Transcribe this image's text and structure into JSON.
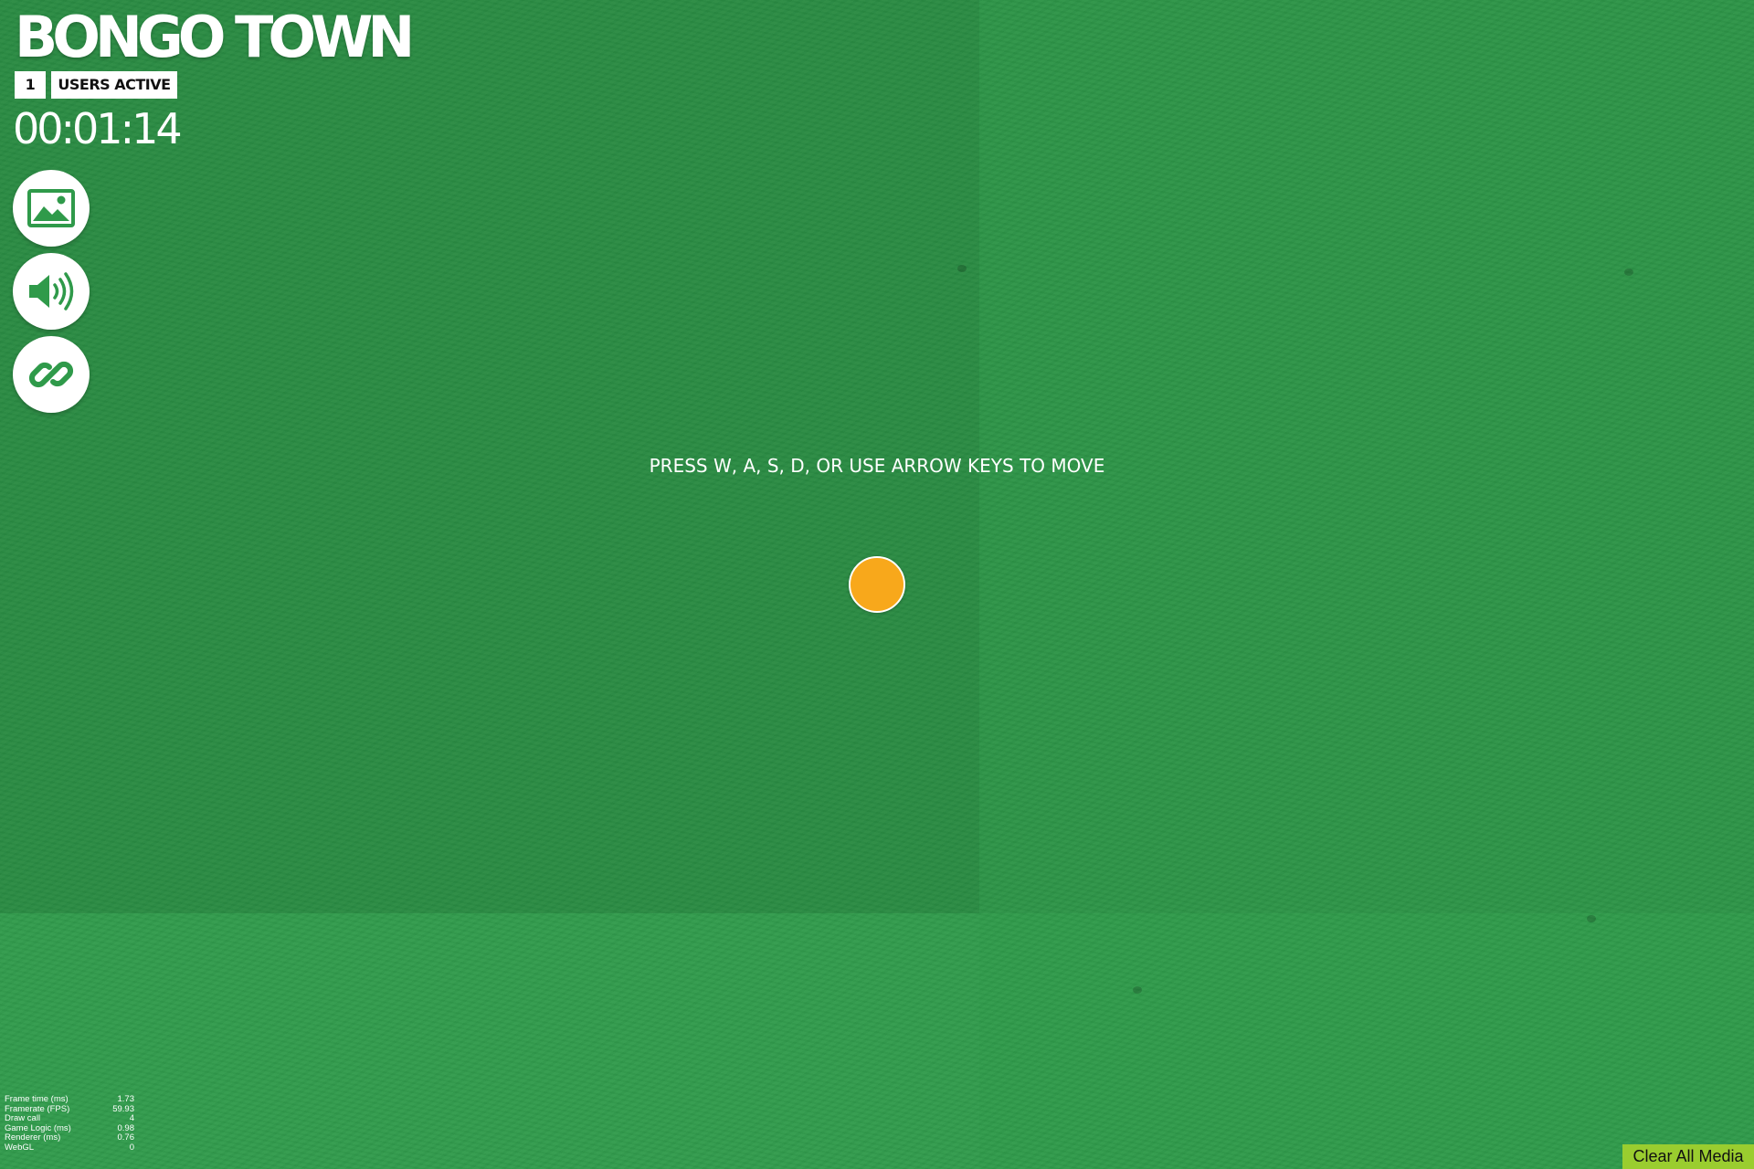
{
  "app": {
    "title": "BONGO TOWN"
  },
  "users": {
    "count": "1",
    "label": "USERS ACTIVE"
  },
  "timer": "00:01:14",
  "toolbar": {
    "buttons": [
      {
        "icon": "image-icon"
      },
      {
        "icon": "sound-icon"
      },
      {
        "icon": "link-icon"
      }
    ]
  },
  "instructions": "PRESS W, A, S, D, OR USE ARROW KEYS TO MOVE",
  "colors": {
    "background": "#2f9a4a",
    "player": "#f8a81b",
    "clear_button": "#9acd2f",
    "icon": "#2f9a4a"
  },
  "stats": [
    {
      "label": "Frame time (ms)",
      "value": "1.73"
    },
    {
      "label": "Framerate (FPS)",
      "value": "59.93"
    },
    {
      "label": "Draw call",
      "value": "4"
    },
    {
      "label": "Game Logic (ms)",
      "value": "0.98"
    },
    {
      "label": "Renderer (ms)",
      "value": "0.76"
    },
    {
      "label": "WebGL",
      "value": "0"
    }
  ],
  "clear_media_label": "Clear All Media"
}
